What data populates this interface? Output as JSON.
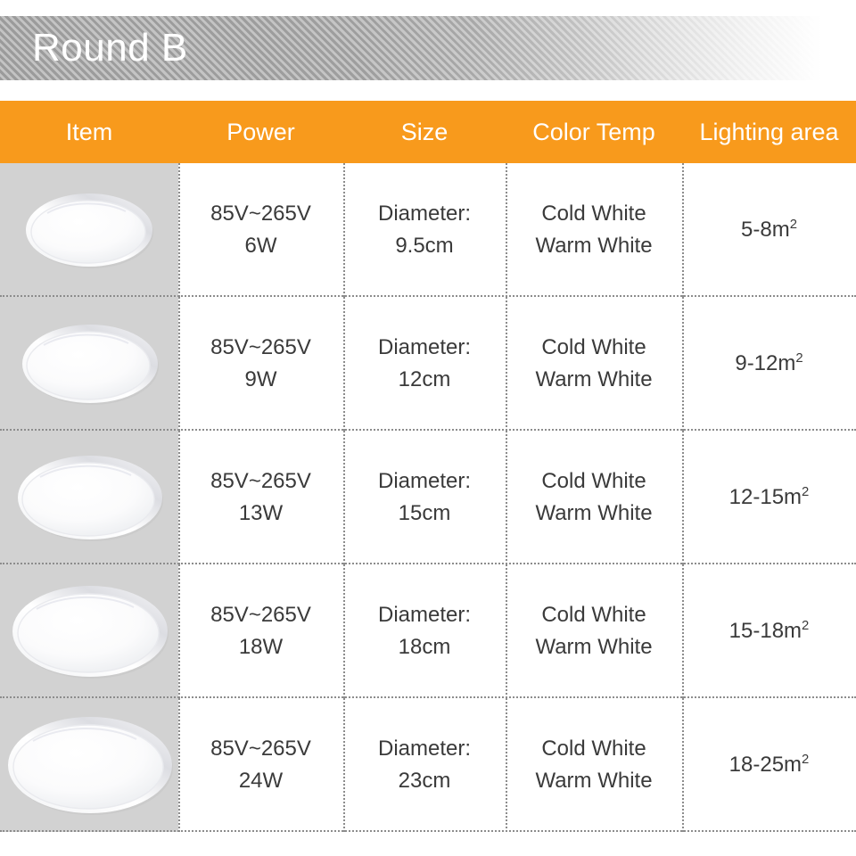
{
  "banner": {
    "title": "Round B"
  },
  "colors": {
    "accent_orange": "#F89A1C",
    "image_column_gray": "#D2D2D2",
    "banner_gray": "#9B9B9B",
    "text_gray": "#3A3A3A",
    "divider_gray": "#8C8C8C"
  },
  "table": {
    "headers": [
      {
        "key": "item",
        "label": "Item"
      },
      {
        "key": "power",
        "label": "Power"
      },
      {
        "key": "size",
        "label": "Size"
      },
      {
        "key": "temp",
        "label": "Color Temp"
      },
      {
        "key": "area",
        "label": "Lighting area"
      }
    ],
    "rows": [
      {
        "item_icon": "round-led-ceiling-panel-light",
        "voltage": "85V~265V",
        "wattage": "6W",
        "size_label": "Diameter:",
        "size_value": "9.5cm",
        "color_temp_1": "Cold White",
        "color_temp_2": "Warm White",
        "lighting_area": "5-8m",
        "lighting_area_unit": "2"
      },
      {
        "item_icon": "round-led-ceiling-panel-light",
        "voltage": "85V~265V",
        "wattage": "9W",
        "size_label": "Diameter:",
        "size_value": "12cm",
        "color_temp_1": "Cold White",
        "color_temp_2": "Warm White",
        "lighting_area": "9-12m",
        "lighting_area_unit": "2"
      },
      {
        "item_icon": "round-led-ceiling-panel-light",
        "voltage": "85V~265V",
        "wattage": "13W",
        "size_label": "Diameter:",
        "size_value": "15cm",
        "color_temp_1": "Cold White",
        "color_temp_2": "Warm White",
        "lighting_area": "12-15m",
        "lighting_area_unit": "2"
      },
      {
        "item_icon": "round-led-ceiling-panel-light",
        "voltage": "85V~265V",
        "wattage": "18W",
        "size_label": "Diameter:",
        "size_value": "18cm",
        "color_temp_1": "Cold White",
        "color_temp_2": "Warm White",
        "lighting_area": "15-18m",
        "lighting_area_unit": "2"
      },
      {
        "item_icon": "round-led-ceiling-panel-light",
        "voltage": "85V~265V",
        "wattage": "24W",
        "size_label": "Diameter:",
        "size_value": "23cm",
        "color_temp_1": "Cold White",
        "color_temp_2": "Warm White",
        "lighting_area": "18-25m",
        "lighting_area_unit": "2"
      }
    ]
  }
}
